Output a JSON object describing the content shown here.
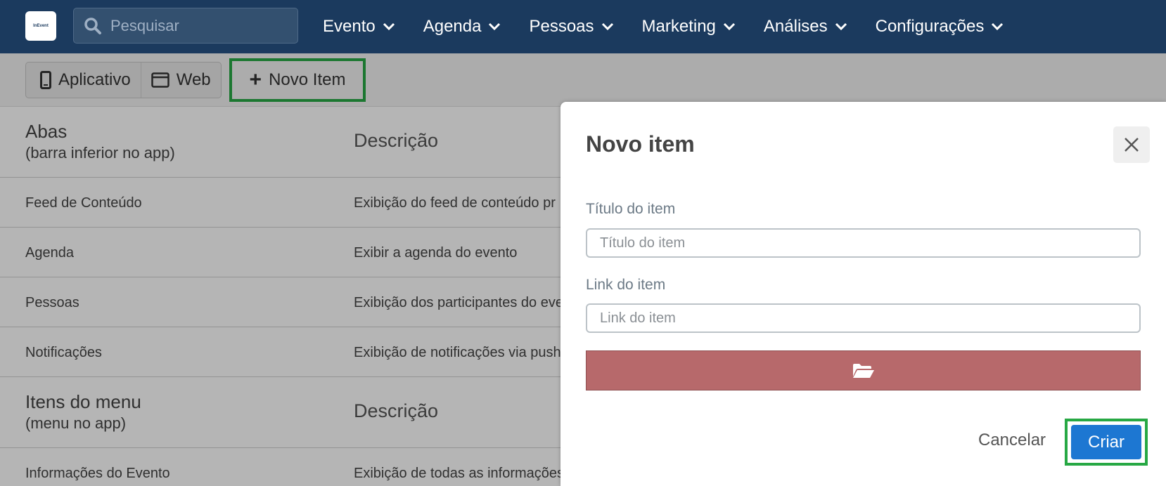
{
  "navbar": {
    "logo_text": "InEvent",
    "search_placeholder": "Pesquisar",
    "menu": [
      {
        "label": "Evento"
      },
      {
        "label": "Agenda"
      },
      {
        "label": "Pessoas"
      },
      {
        "label": "Marketing"
      },
      {
        "label": "Análises"
      },
      {
        "label": "Configurações"
      }
    ]
  },
  "toolbar": {
    "app_label": "Aplicativo",
    "web_label": "Web",
    "new_item_label": "Novo Item"
  },
  "table": {
    "tabs_header": {
      "title": "Abas",
      "subtitle": "(barra inferior no app)",
      "desc_header": "Descrição"
    },
    "tab_rows": [
      {
        "name": "Feed de Conteúdo",
        "desc": "Exibição do feed de conteúdo pr"
      },
      {
        "name": "Agenda",
        "desc": "Exibir a agenda do evento"
      },
      {
        "name": "Pessoas",
        "desc": "Exibição dos participantes do eve"
      },
      {
        "name": "Notificações",
        "desc": "Exibição de notificações via push"
      }
    ],
    "menu_header": {
      "title": "Itens do menu",
      "subtitle": "(menu no app)",
      "desc_header": "Descrição"
    },
    "menu_rows": [
      {
        "name": "Informações do Evento",
        "desc": "Exibição de todas as informações"
      }
    ]
  },
  "modal": {
    "title": "Novo item",
    "title_field_label": "Título do item",
    "title_field_placeholder": "Título do item",
    "link_field_label": "Link do item",
    "link_field_placeholder": "Link do item",
    "cancel_label": "Cancelar",
    "create_label": "Criar"
  },
  "colors": {
    "navbar": "#1b3a5e",
    "highlight": "#27a844",
    "upload_button": "#b7696b",
    "primary_button": "#1d77d2"
  },
  "icons": {
    "search": "search-icon",
    "chevron": "chevron-down-icon",
    "mobile": "mobile-phone-icon",
    "browser": "browser-window-icon",
    "plus": "plus-icon",
    "close": "close-icon",
    "folder": "folder-open-icon"
  }
}
